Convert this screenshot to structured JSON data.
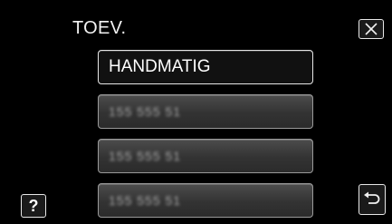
{
  "header": {
    "title": "TOEV."
  },
  "buttons": {
    "close_icon": "close-icon",
    "help_label": "?",
    "back_icon": "return-arrow-icon"
  },
  "list": {
    "items": [
      {
        "label": "HANDMATIG",
        "selected": true
      },
      {
        "label": "155 555 51",
        "selected": false
      },
      {
        "label": "155 555 51",
        "selected": false
      },
      {
        "label": "155 555 51",
        "selected": false
      }
    ]
  },
  "colors": {
    "background": "#000000",
    "item_border": "#9a9a9a",
    "selected_border": "#e6e6e6",
    "text": "#ffffff"
  }
}
